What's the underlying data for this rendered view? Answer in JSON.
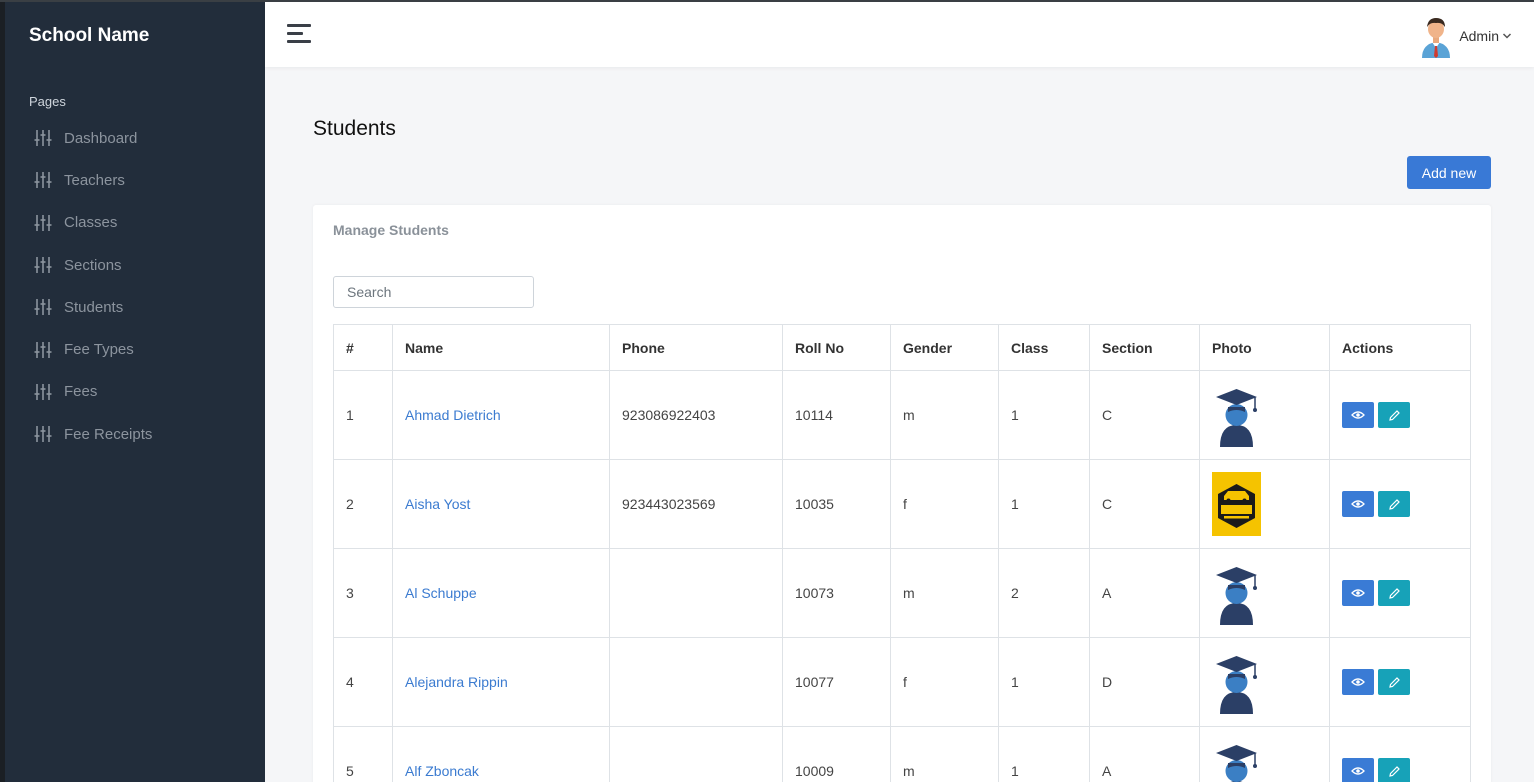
{
  "sidebar": {
    "brand": "School Name",
    "section_label": "Pages",
    "items": [
      {
        "label": "Dashboard",
        "icon": "sliders-icon"
      },
      {
        "label": "Teachers",
        "icon": "sliders-icon"
      },
      {
        "label": "Classes",
        "icon": "sliders-icon"
      },
      {
        "label": "Sections",
        "icon": "sliders-icon"
      },
      {
        "label": "Students",
        "icon": "sliders-icon"
      },
      {
        "label": "Fee Types",
        "icon": "sliders-icon"
      },
      {
        "label": "Fees",
        "icon": "sliders-icon"
      },
      {
        "label": "Fee Receipts",
        "icon": "sliders-icon"
      }
    ]
  },
  "header": {
    "menu_icon": "hamburger-icon",
    "user_name": "Admin"
  },
  "page": {
    "title": "Students",
    "add_button": "Add new"
  },
  "card": {
    "title": "Manage Students",
    "search_placeholder": "Search"
  },
  "table": {
    "columns": [
      "#",
      "Name",
      "Phone",
      "Roll No",
      "Gender",
      "Class",
      "Section",
      "Photo",
      "Actions"
    ],
    "rows": [
      {
        "num": "1",
        "name": "Ahmad Dietrich",
        "phone": "923086922403",
        "roll": "10114",
        "gender": "m",
        "class": "1",
        "section": "C",
        "photo": "graduate-icon"
      },
      {
        "num": "2",
        "name": "Aisha Yost",
        "phone": "923443023569",
        "roll": "10035",
        "gender": "f",
        "class": "1",
        "section": "C",
        "photo": "royal-logo"
      },
      {
        "num": "3",
        "name": "Al Schuppe",
        "phone": "",
        "roll": "10073",
        "gender": "m",
        "class": "2",
        "section": "A",
        "photo": "graduate-icon"
      },
      {
        "num": "4",
        "name": "Alejandra Rippin",
        "phone": "",
        "roll": "10077",
        "gender": "f",
        "class": "1",
        "section": "D",
        "photo": "graduate-icon"
      },
      {
        "num": "5",
        "name": "Alf Zboncak",
        "phone": "",
        "roll": "10009",
        "gender": "m",
        "class": "1",
        "section": "A",
        "photo": "graduate-icon"
      }
    ]
  },
  "colors": {
    "sidebar_bg": "#222d3b",
    "primary": "#3979d6",
    "info": "#17a2b8",
    "link": "#3b7bd0"
  }
}
